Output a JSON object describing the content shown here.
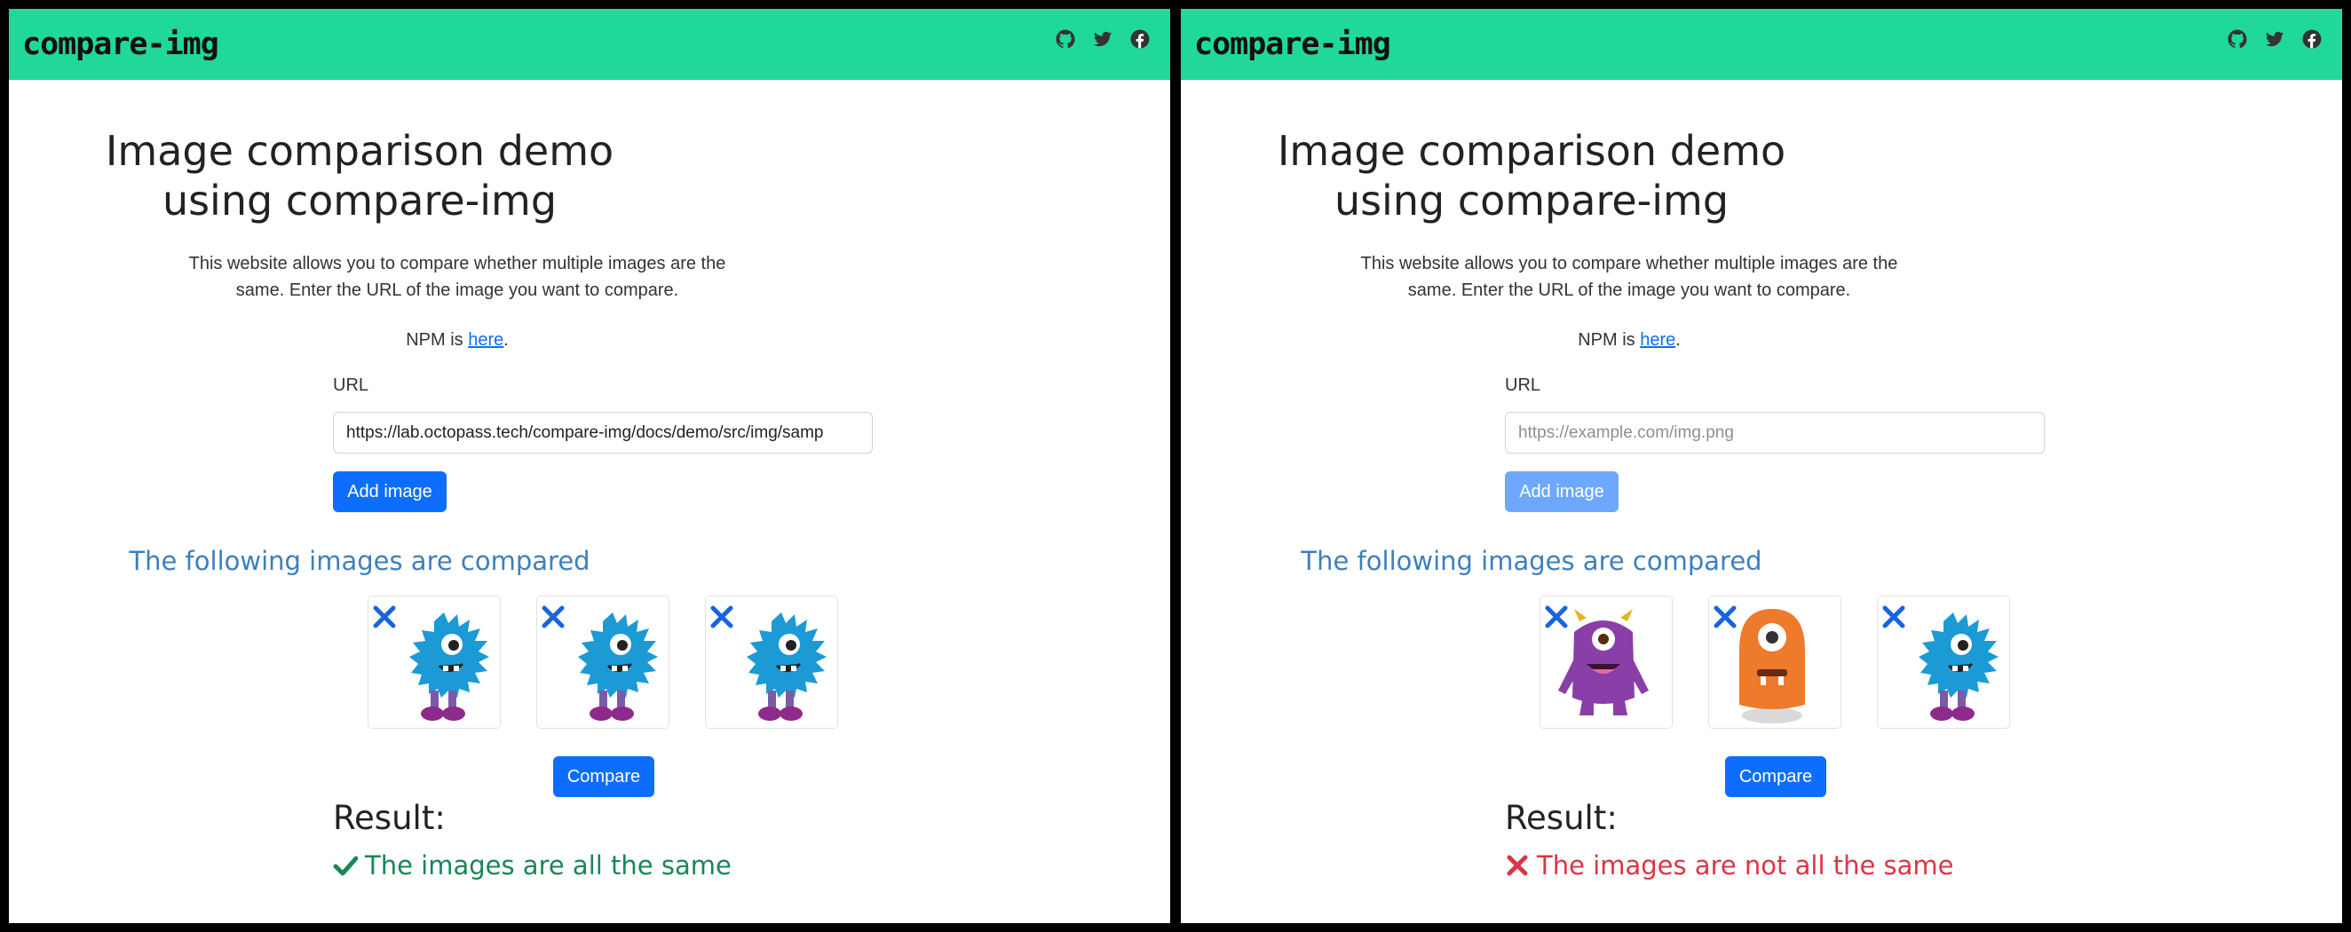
{
  "panels": [
    {
      "brand": "compare-img",
      "title_line1": "Image comparison demo",
      "title_line2": "using compare-img",
      "desc_line1": "This website allows you to compare whether multiple images are the",
      "desc_line2": "same. Enter the URL of the image you want to compare.",
      "npm_prefix": "NPM is ",
      "npm_link": "here",
      "npm_suffix": ".",
      "url_label": "URL",
      "url_value": "https://lab.octopass.tech/compare-img/docs/demo/src/img/samp",
      "url_placeholder": "https://example.com/img.png",
      "add_label": "Add image",
      "add_disabled": false,
      "compared_title": "The following images are compared",
      "images": [
        "blue-monster-image",
        "blue-monster-image",
        "blue-monster-image"
      ],
      "compare_label": "Compare",
      "result_label": "Result:",
      "result_text": "The images are all the same",
      "result_status": "same",
      "result_color": "#198754"
    },
    {
      "brand": "compare-img",
      "title_line1": "Image comparison demo",
      "title_line2": "using compare-img",
      "desc_line1": "This website allows you to compare whether multiple images are the",
      "desc_line2": "same. Enter the URL of the image you want to compare.",
      "npm_prefix": "NPM is ",
      "npm_link": "here",
      "npm_suffix": ".",
      "url_label": "URL",
      "url_value": "",
      "url_placeholder": "https://example.com/img.png",
      "add_label": "Add image",
      "add_disabled": true,
      "compared_title": "The following images are compared",
      "images": [
        "purple-monster-image",
        "orange-monster-image",
        "blue-monster-image"
      ],
      "compare_label": "Compare",
      "result_label": "Result:",
      "result_text": "The images are not all the same",
      "result_status": "different",
      "result_color": "#dc3545"
    }
  ],
  "colors": {
    "navbar": "#20d89a",
    "primary": "#0d6efd",
    "primary_disabled": "#6ea8fe",
    "heading_blue": "#3d7fbf",
    "success": "#198754",
    "danger": "#dc3545"
  },
  "social_icons": [
    "github-icon",
    "twitter-icon",
    "facebook-icon"
  ]
}
